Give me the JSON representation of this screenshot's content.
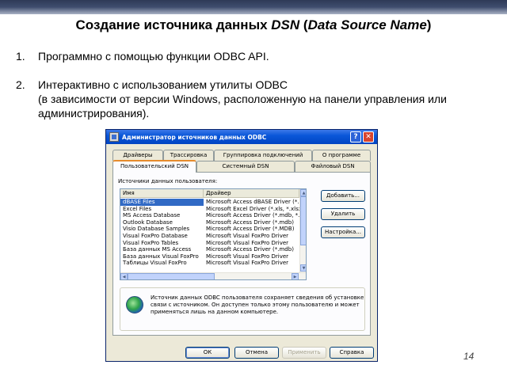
{
  "slide": {
    "title_main": "Создание источника данных ",
    "title_dsn": "DSN",
    "title_paren_open": " (",
    "title_full": "Data Source Name",
    "title_paren_close": ")",
    "bullets": [
      {
        "num": "1.",
        "text": "Программно с помощью функции ODBC API."
      },
      {
        "num": "2.",
        "text": "Интерактивно с использованием утилиты ODBC",
        "text2": "(в зависимости от версии Windows, расположенную на панели управления или администрирования)."
      }
    ],
    "page_number": "14"
  },
  "dialog": {
    "title": "Администратор источников данных ODBC",
    "help_btn": "?",
    "close_btn": "✕",
    "tabs_top": [
      "Драйверы",
      "Трассировка",
      "Группировка подключений",
      "О программе"
    ],
    "tabs_bottom": [
      "Пользовательский DSN",
      "Системный DSN",
      "Файловый DSN"
    ],
    "panel_label": "Источники данных пользователя:",
    "columns": {
      "name": "Имя",
      "driver": "Драйвер"
    },
    "rows": [
      {
        "name": "dBASE Files",
        "driver": "Microsoft Access dBASE Driver (*."
      },
      {
        "name": "Excel Files",
        "driver": "Microsoft Excel Driver (*.xls, *.xlsx"
      },
      {
        "name": "MS Access Database",
        "driver": "Microsoft Access Driver (*.mdb, *."
      },
      {
        "name": "Outlook Database",
        "driver": "Microsoft Access Driver (*.mdb)"
      },
      {
        "name": "Visio Database Samples",
        "driver": "Microsoft Access Driver (*.MDB)"
      },
      {
        "name": "Visual FoxPro Database",
        "driver": "Microsoft Visual FoxPro Driver"
      },
      {
        "name": "Visual FoxPro Tables",
        "driver": "Microsoft Visual FoxPro Driver"
      },
      {
        "name": "База данных MS Access",
        "driver": "Microsoft Access Driver (*.mdb)"
      },
      {
        "name": "База данных Visual FoxPro",
        "driver": "Microsoft Visual FoxPro Driver"
      },
      {
        "name": "Таблицы Visual FoxPro",
        "driver": "Microsoft Visual FoxPro Driver"
      }
    ],
    "buttons": {
      "add": "Добавить...",
      "remove": "Удалить",
      "configure": "Настройка..."
    },
    "info_text": "Источник данных ODBC пользователя сохраняет сведения об установке связи с источником. Он доступен только этому пользователю и может применяться лишь на данном компьютере.",
    "footer": {
      "ok": "ОК",
      "cancel": "Отмена",
      "apply": "Применить",
      "help": "Справка"
    }
  }
}
